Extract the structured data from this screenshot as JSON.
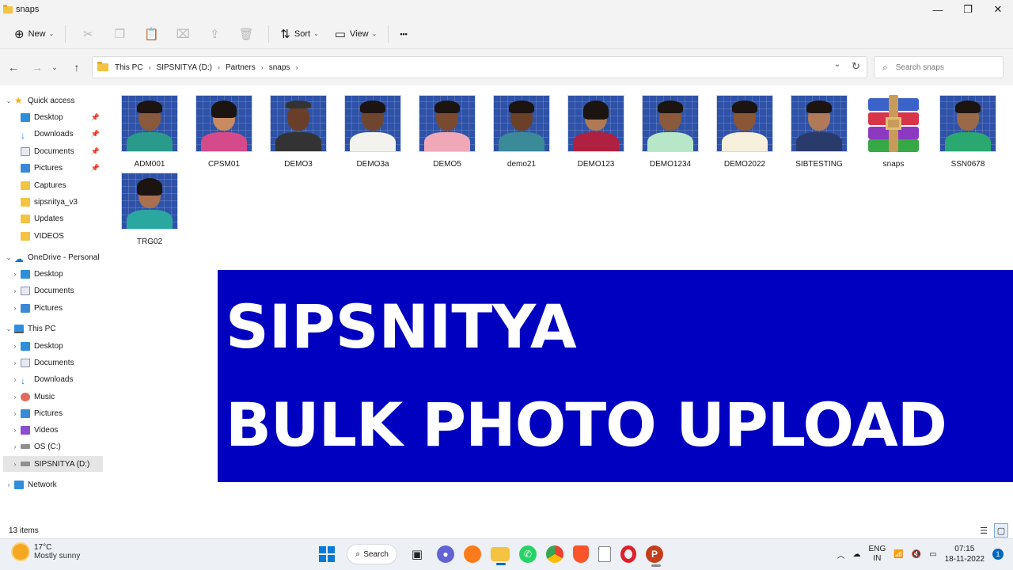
{
  "window": {
    "title": "snaps",
    "minimize": "—",
    "maximize": "❐",
    "close": "✕"
  },
  "toolbar": {
    "new_label": "New",
    "sort_label": "Sort",
    "view_label": "View",
    "more": "•••"
  },
  "address": {
    "crumbs": [
      "This PC",
      "SIPSNITYA (D:)",
      "Partners",
      "snaps"
    ],
    "search_placeholder": "Search snaps"
  },
  "sidebar": {
    "quick_access": "Quick access",
    "quick_items": [
      "Desktop",
      "Downloads",
      "Documents",
      "Pictures",
      "Captures",
      "sipsnitya_v3",
      "Updates",
      "VIDEOS"
    ],
    "onedrive": "OneDrive - Personal",
    "onedrive_items": [
      "Desktop",
      "Documents",
      "Pictures"
    ],
    "this_pc": "This PC",
    "pc_items": [
      "Desktop",
      "Documents",
      "Downloads",
      "Music",
      "Pictures",
      "Videos",
      "OS (C:)",
      "SIPSNITYA (D:)"
    ],
    "network": "Network"
  },
  "files": [
    {
      "name": "ADM001",
      "bg": "#2a9a8a"
    },
    {
      "name": "CPSM01",
      "bg": "#d44a8a"
    },
    {
      "name": "DEMO3",
      "bg": "#333333"
    },
    {
      "name": "DEMO3a",
      "bg": "#f2f2ee"
    },
    {
      "name": "DEMO5",
      "bg": "#f0a8b8"
    },
    {
      "name": "demo21",
      "bg": "#3a8a98"
    },
    {
      "name": "DEMO123",
      "bg": "#b02040"
    },
    {
      "name": "DEMO1234",
      "bg": "#b8e6c8"
    },
    {
      "name": "DEMO2022",
      "bg": "#f6f0dc"
    },
    {
      "name": "SIBTESTING",
      "bg": "#2a3a6a"
    },
    {
      "name": "snaps",
      "bg": ""
    },
    {
      "name": "SSN0678",
      "bg": "#2aa870"
    },
    {
      "name": "TRG02",
      "bg": "#2aa8a0"
    }
  ],
  "banner": {
    "line1": "SIPSNITYA",
    "line2": "BULK PHOTO UPLOAD"
  },
  "status": {
    "items_count": "13 items"
  },
  "taskbar": {
    "temp": "17°C",
    "weather": "Mostly sunny",
    "search_label": "Search",
    "lang1": "ENG",
    "lang2": "IN",
    "time": "07:15",
    "date": "18-11-2022",
    "notifications": "1"
  }
}
